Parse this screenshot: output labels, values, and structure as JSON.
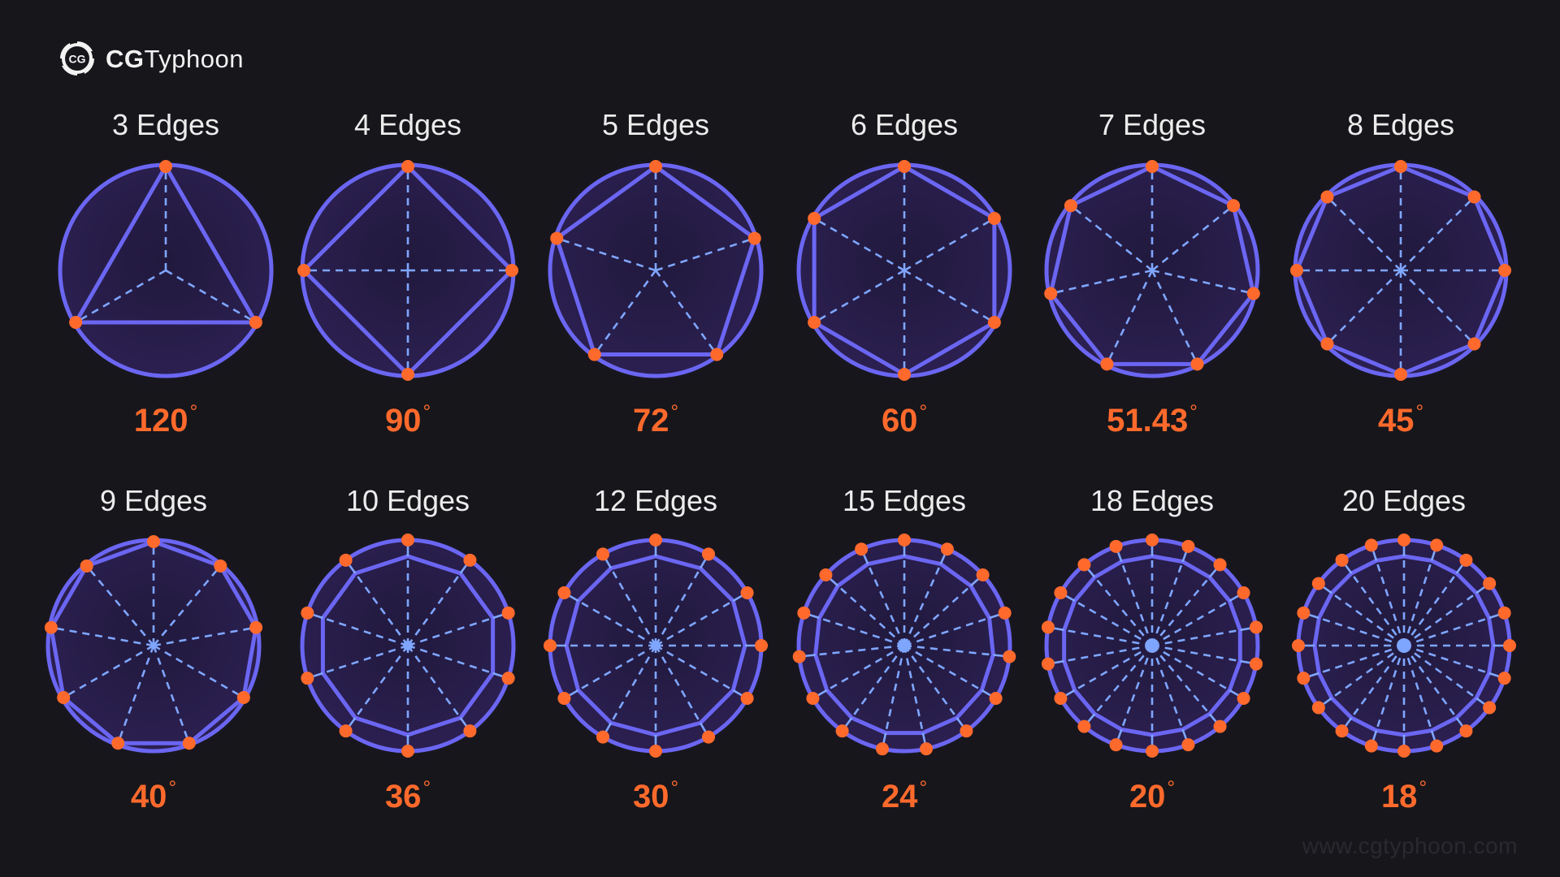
{
  "brand": {
    "icon": "cg-typhoon-logo-icon",
    "name_bold": "CG",
    "name_light": "Typhoon"
  },
  "colors": {
    "background": "#17161b",
    "circle_fill": "#261d45",
    "circle_stroke": "#6b66f2",
    "polygon_stroke": "#6b66f2",
    "spoke": "#7fa6ff",
    "vertex": "#ff6a2c",
    "angle_text": "#ff6a2c",
    "title_text": "#ececec"
  },
  "degree_symbol": "°",
  "shapes": [
    {
      "edges": 3,
      "title": "3 Edges",
      "angle": "120"
    },
    {
      "edges": 4,
      "title": "4 Edges",
      "angle": "90"
    },
    {
      "edges": 5,
      "title": "5 Edges",
      "angle": "72"
    },
    {
      "edges": 6,
      "title": "6 Edges",
      "angle": "60"
    },
    {
      "edges": 7,
      "title": "7 Edges",
      "angle": "51.43"
    },
    {
      "edges": 8,
      "title": "8 Edges",
      "angle": "45"
    },
    {
      "edges": 9,
      "title": "9 Edges",
      "angle": "40"
    },
    {
      "edges": 10,
      "title": "10 Edges",
      "angle": "36"
    },
    {
      "edges": 12,
      "title": "12 Edges",
      "angle": "30"
    },
    {
      "edges": 15,
      "title": "15 Edges",
      "angle": "24"
    },
    {
      "edges": 18,
      "title": "18 Edges",
      "angle": "20"
    },
    {
      "edges": 20,
      "title": "20 Edges",
      "angle": "18"
    }
  ],
  "watermark": "www.cgtyphoon.com"
}
